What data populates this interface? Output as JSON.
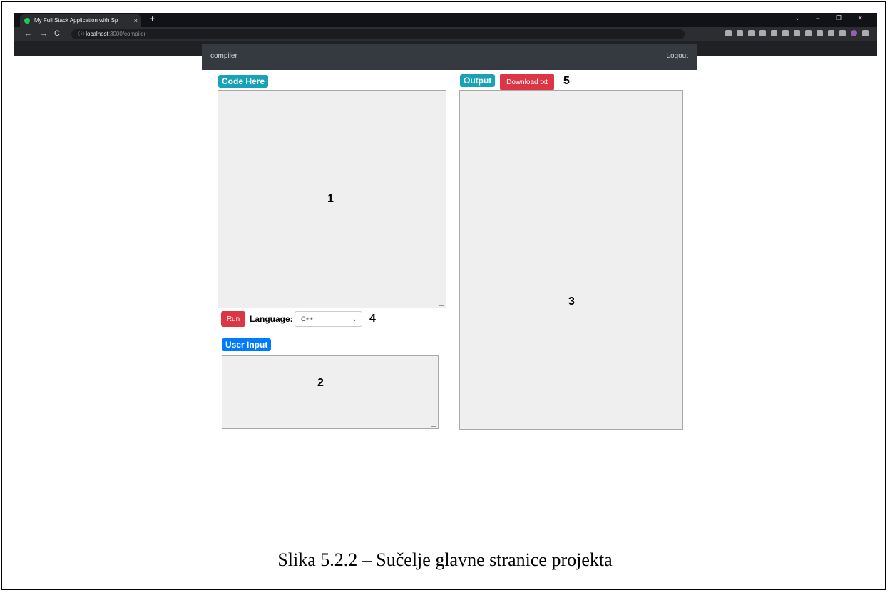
{
  "browser": {
    "tab_title": "My Full Stack Application with Sp",
    "tab_close": "×",
    "new_tab": "+",
    "window_controls": "⌄ – ❐ ✕",
    "nav": {
      "back": "←",
      "forward": "→",
      "reload": "C",
      "info": "ⓘ"
    },
    "url_host": "localhost",
    "url_path": ":3000/compiler"
  },
  "navbar": {
    "brand": "compiler",
    "logout": "Logout"
  },
  "code_panel": {
    "label": "Code Here",
    "marker": "1"
  },
  "controls": {
    "run_label": "Run",
    "language_label": "Language:",
    "language_value": "C++",
    "marker": "4"
  },
  "input_panel": {
    "label": "User Input",
    "marker": "2"
  },
  "output_panel": {
    "label": "Output",
    "download_label": "Download txt",
    "download_marker": "5",
    "marker": "3"
  },
  "caption": "Slika 5.2.2 – Sučelje glavne stranice projekta",
  "colors": {
    "teal": "#17a2b8",
    "blue": "#007bff",
    "red": "#dc3545",
    "navbar": "#343a40"
  }
}
